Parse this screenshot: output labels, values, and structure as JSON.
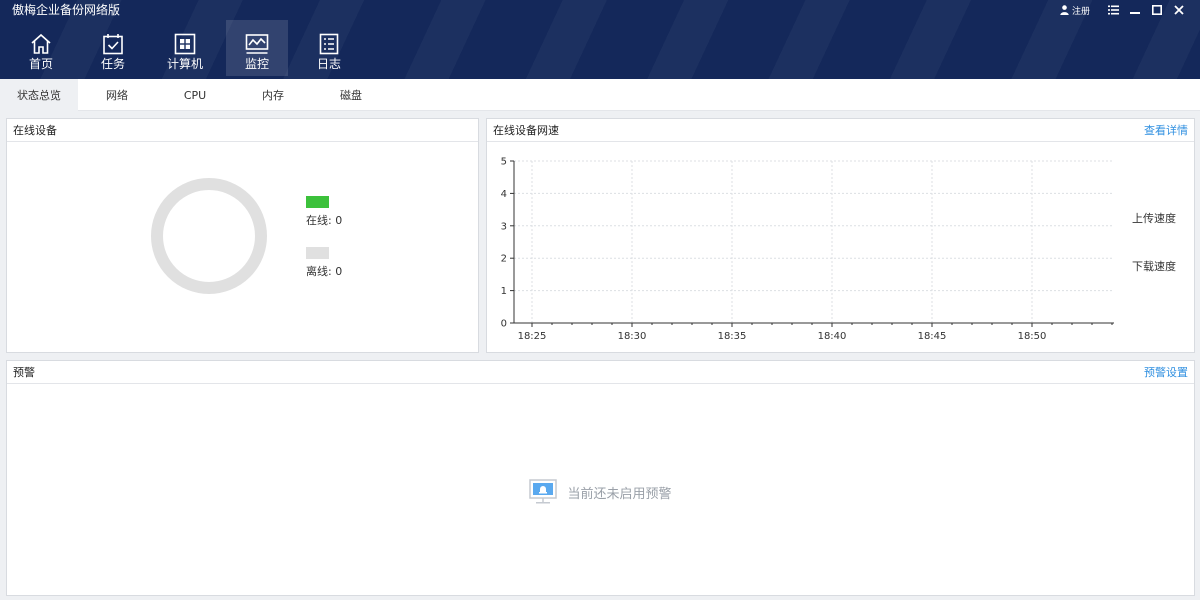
{
  "app": {
    "title": "傲梅企业备份网络版"
  },
  "window_controls": {
    "user_label": "注册",
    "icons": [
      "user-icon",
      "menu-icon",
      "minimize-icon",
      "maximize-icon",
      "close-icon"
    ]
  },
  "nav": {
    "items": [
      {
        "label": "首页",
        "icon": "home-icon",
        "active": false
      },
      {
        "label": "任务",
        "icon": "task-icon",
        "active": false
      },
      {
        "label": "计算机",
        "icon": "computer-icon",
        "active": false
      },
      {
        "label": "监控",
        "icon": "monitor-icon",
        "active": true
      },
      {
        "label": "日志",
        "icon": "log-icon",
        "active": false
      }
    ]
  },
  "subtabs": [
    {
      "label": "状态总览",
      "active": true
    },
    {
      "label": "网络",
      "active": false
    },
    {
      "label": "CPU",
      "active": false
    },
    {
      "label": "内存",
      "active": false
    },
    {
      "label": "磁盘",
      "active": false
    }
  ],
  "online_panel": {
    "title": "在线设备",
    "legend": [
      {
        "label": "在线: 0",
        "color": "#3cc13b"
      },
      {
        "label": "离线: 0",
        "color": "#e0e0e0"
      }
    ],
    "chart_data": {
      "type": "pie",
      "values": [
        0,
        0
      ],
      "labels": [
        "在线: 0",
        "离线: 0"
      ],
      "colors": [
        "#3cc13b",
        "#e0e0e0"
      ]
    }
  },
  "speed_panel": {
    "title": "在线设备网速",
    "link": "查看详情",
    "chart_data": {
      "type": "line",
      "x_ticks": [
        "18:25",
        "18:30",
        "18:35",
        "18:40",
        "18:45",
        "18:50"
      ],
      "y_ticks": [
        "0",
        "1",
        "2",
        "3",
        "4",
        "5"
      ],
      "ylim": [
        0,
        5
      ],
      "grid": true,
      "series": [
        {
          "name": "上传速度",
          "values": []
        },
        {
          "name": "下载速度",
          "values": []
        }
      ]
    }
  },
  "alert_panel": {
    "title": "预警",
    "link": "预警设置",
    "empty_text": "当前还未启用预警",
    "empty_icon": "alarm-monitor-icon"
  },
  "colors": {
    "header_bg": "#14285a",
    "accent_link": "#2f8fe0",
    "online_green": "#3cc13b",
    "offline_gray": "#e0e0e0"
  }
}
